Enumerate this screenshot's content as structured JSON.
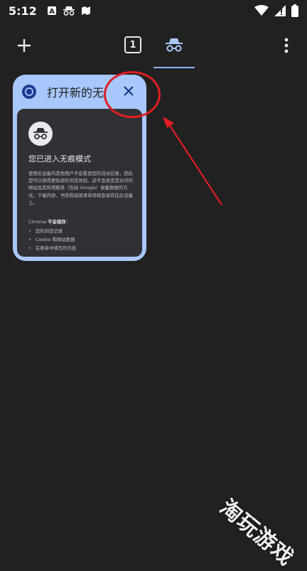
{
  "status_bar": {
    "time": "5:12",
    "left_icons": [
      "font-a-icon",
      "incognito-icon",
      "map-icon"
    ],
    "right_icons": [
      "wifi-icon",
      "signal-icon",
      "battery-icon"
    ]
  },
  "toolbar": {
    "new_tab_icon": "plus-icon",
    "tab_count": "1",
    "incognito_icon": "incognito-icon",
    "menu_icon": "more-vert-icon",
    "accent": "#8ab4f8"
  },
  "tab_card": {
    "title": "打开新的无",
    "favicon": "chrome-icon",
    "close_icon": "close-icon",
    "card_color": "#a8c7fa",
    "thumbnail": {
      "heading": "您已进入无痕模式",
      "paragraph": "使用此设备的其他用户不会看到您的活动记录，因此您可以获得更私密的浏览体验。这不会改变您访问的网站及其所用服务（包括 Google）收集数据的方式。下载内容、书签和阅读清单项将会保存在此设备上。",
      "saves_prefix": "Chrome ",
      "saves_bold": "不会保存",
      "saves_suffix": "：",
      "list": [
        "您的浏览记录",
        "Cookie 和网站数据",
        "在表单中填写的信息"
      ]
    }
  },
  "annotation": {
    "color": "#e01e23"
  },
  "watermark": {
    "text": "淘玩游戏"
  }
}
